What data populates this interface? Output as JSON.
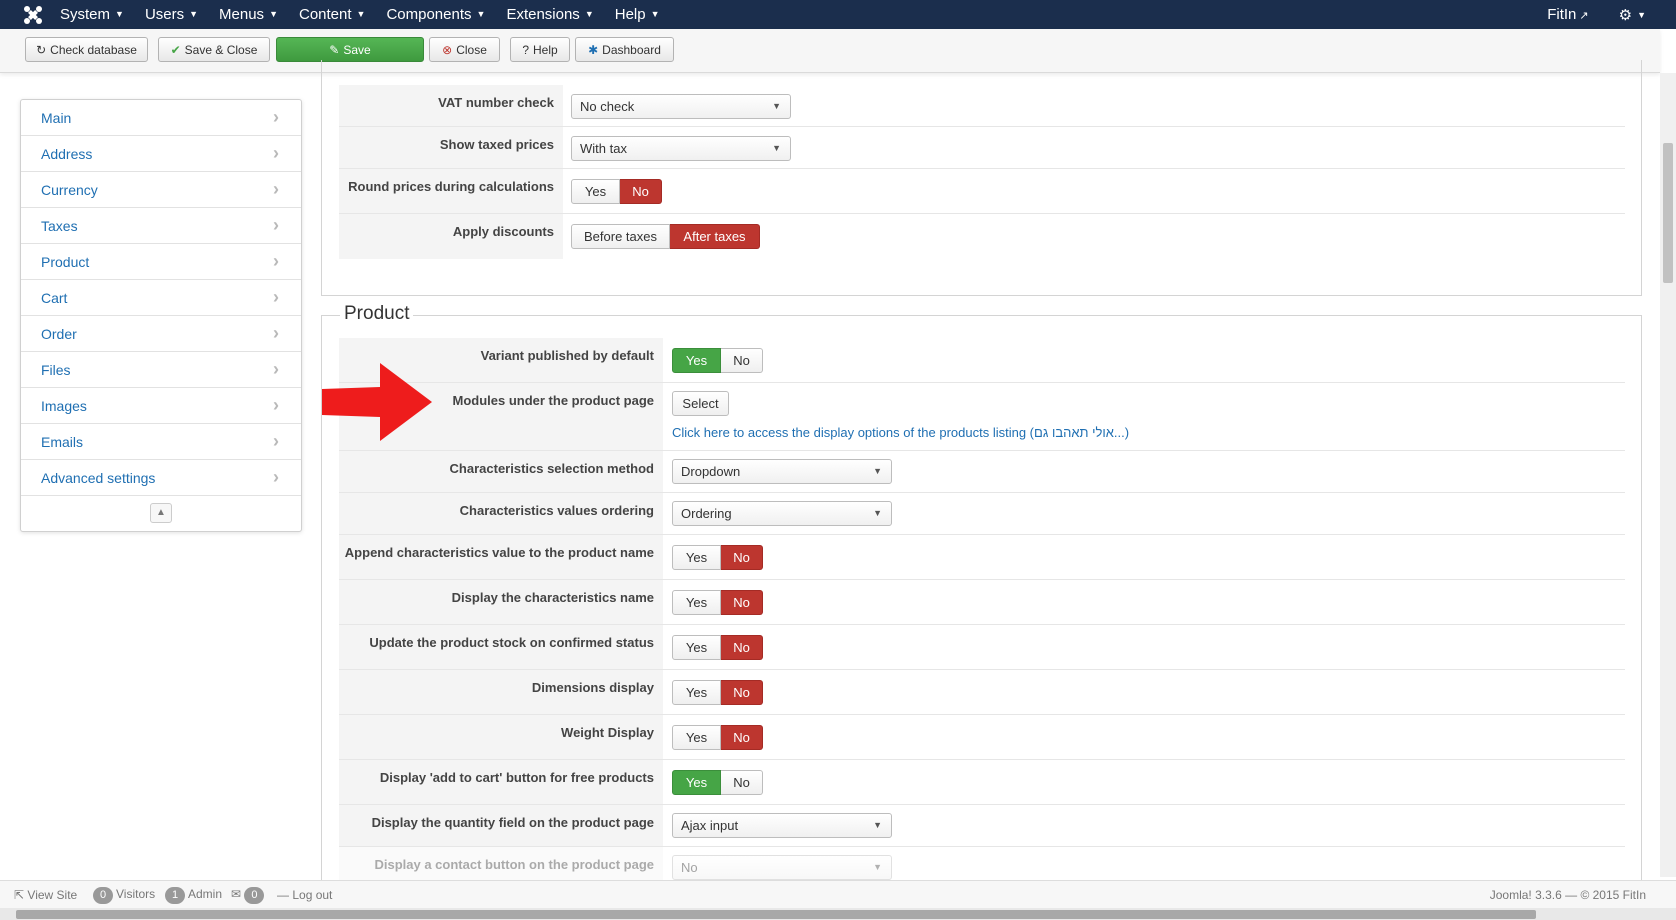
{
  "navbar": {
    "menu": [
      "System",
      "Users",
      "Menus",
      "Content",
      "Components",
      "Extensions",
      "Help"
    ],
    "site_name": "FitIn",
    "colors": {
      "background": "#1b2e4d"
    }
  },
  "toolbar": {
    "check_database": "Check database",
    "save_close": "Save & Close",
    "save": "Save",
    "close": "Close",
    "help": "Help",
    "dashboard": "Dashboard"
  },
  "sidebar": {
    "items": [
      "Main",
      "Address",
      "Currency",
      "Taxes",
      "Product",
      "Cart",
      "Order",
      "Files",
      "Images",
      "Emails",
      "Advanced settings"
    ]
  },
  "taxes_section": {
    "vat_number_check": {
      "label": "VAT number check",
      "value": "No check"
    },
    "show_taxed_prices": {
      "label": "Show taxed prices",
      "value": "With tax"
    },
    "round_prices": {
      "label": "Round prices during calculations",
      "yes": "Yes",
      "no": "No",
      "selected": "No"
    },
    "apply_discounts": {
      "label": "Apply discounts",
      "option_a": "Before taxes",
      "option_b": "After taxes",
      "selected": "After taxes"
    }
  },
  "product_section": {
    "legend": "Product",
    "variant_published": {
      "label": "Variant published by default",
      "yes": "Yes",
      "no": "No",
      "selected": "Yes"
    },
    "modules_under_product": {
      "label": "Modules under the product page",
      "button": "Select",
      "link": "Click here to access the display options of the products listing (אולי תאהבו גם...)"
    },
    "characteristics_selection": {
      "label": "Characteristics selection method",
      "value": "Dropdown"
    },
    "characteristics_ordering": {
      "label": "Characteristics values ordering",
      "value": "Ordering"
    },
    "append_characteristics": {
      "label": "Append characteristics value to the product name",
      "yes": "Yes",
      "no": "No",
      "selected": "No"
    },
    "display_characteristics_name": {
      "label": "Display the characteristics name",
      "yes": "Yes",
      "no": "No",
      "selected": "No"
    },
    "update_stock": {
      "label": "Update the product stock on confirmed status",
      "yes": "Yes",
      "no": "No",
      "selected": "No"
    },
    "dimensions_display": {
      "label": "Dimensions display",
      "yes": "Yes",
      "no": "No",
      "selected": "No"
    },
    "weight_display": {
      "label": "Weight Display",
      "yes": "Yes",
      "no": "No",
      "selected": "No"
    },
    "add_to_cart_free": {
      "label": "Display 'add to cart' button for free products",
      "yes": "Yes",
      "no": "No",
      "selected": "Yes"
    },
    "quantity_field": {
      "label": "Display the quantity field on the product page",
      "value": "Ajax input"
    },
    "contact_button": {
      "label": "Display a contact button on the product page",
      "value": "No"
    }
  },
  "statusbar": {
    "view_site": "View Site",
    "visitors_count": "0",
    "visitors": "Visitors",
    "admin_count": "1",
    "admin": "Admin",
    "messages_count": "0",
    "logout": "Log out",
    "version": "Joomla! 3.3.6 — © 2015 FitIn"
  },
  "colors": {
    "accent_red": "#bd362f",
    "accent_green": "#46a546",
    "link": "#1f6fb2"
  }
}
